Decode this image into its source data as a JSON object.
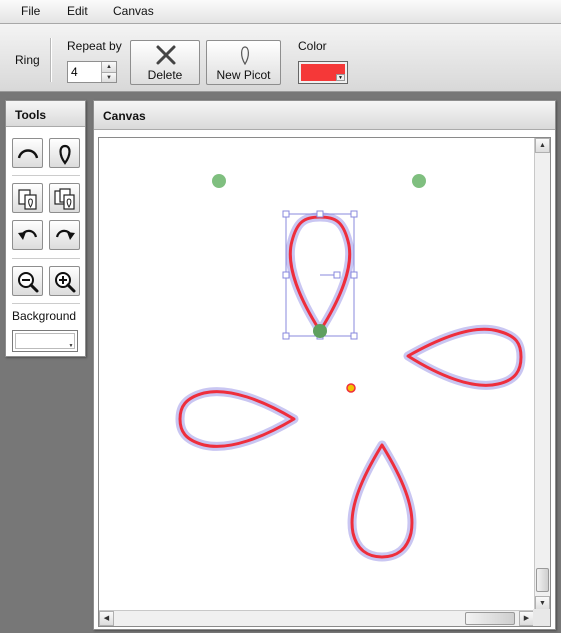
{
  "menu": {
    "items": [
      {
        "label": "File"
      },
      {
        "label": "Edit"
      },
      {
        "label": "Canvas"
      }
    ]
  },
  "toolbar": {
    "ring_label": "Ring",
    "repeat_label": "Repeat by",
    "repeat_value": "4",
    "delete_label": "Delete",
    "new_picot_label": "New Picot",
    "color_label": "Color",
    "color_value": "#f53838"
  },
  "tools_panel": {
    "title": "Tools",
    "background_label": "Background",
    "tools": [
      {
        "icon": "arc-icon"
      },
      {
        "icon": "picot-icon"
      },
      {
        "icon": "copy-icon"
      },
      {
        "icon": "paste-icon"
      },
      {
        "icon": "undo-icon"
      },
      {
        "icon": "redo-icon"
      },
      {
        "icon": "zoom-out-icon"
      },
      {
        "icon": "zoom-in-icon"
      }
    ]
  },
  "canvas_panel": {
    "title": "Canvas"
  },
  "colors": {
    "stroke": "#ee2e3c",
    "halo": "#c9c6f2",
    "handle": "#7fbf7f",
    "selection": "#8888dd",
    "center_dot": "#f2c200"
  }
}
